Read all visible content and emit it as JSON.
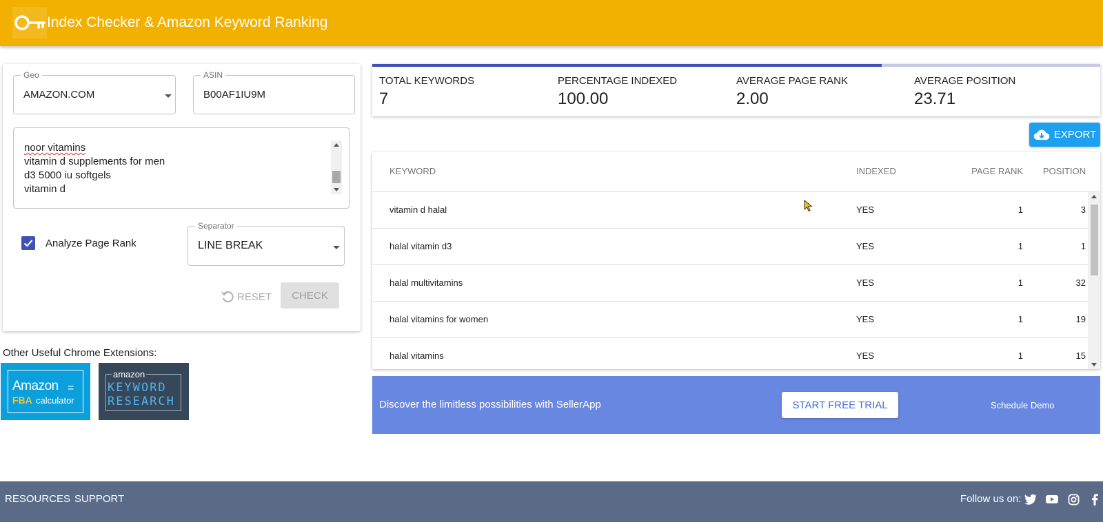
{
  "header": {
    "title": "Index Checker & Amazon Keyword Ranking",
    "logo_icon": "key-icon",
    "bg_color": "#f2b000"
  },
  "form": {
    "geo": {
      "label": "Geo",
      "value": "AMAZON.COM"
    },
    "asin": {
      "label": "ASIN",
      "value": "B00AF1IU9M"
    },
    "keywords": [
      "noor vitamins",
      "vitamin d supplements for men",
      "d3 5000 iu softgels",
      "vitamin d"
    ],
    "analyze_page_rank": {
      "label": "Analyze Page Rank",
      "checked": true
    },
    "separator": {
      "label": "Separator",
      "value": "LINE BREAK"
    },
    "reset_label": "RESET",
    "check_label": "CHECK"
  },
  "extensions": {
    "label": "Other Useful Chrome Extensions:",
    "fba": {
      "line1": "Amazon",
      "line2a": "FBA",
      "line2b": "calculator"
    },
    "kr": {
      "line1": "amazon",
      "line2": "KEYWORD",
      "line3": "RESEARCH"
    }
  },
  "stats": {
    "progress": 0.7,
    "items": [
      {
        "label": "TOTAL KEYWORDS",
        "value": "7"
      },
      {
        "label": "PERCENTAGE INDEXED",
        "value": "100.00"
      },
      {
        "label": "AVERAGE PAGE RANK",
        "value": "2.00"
      },
      {
        "label": "AVERAGE POSITION",
        "value": "23.71"
      }
    ]
  },
  "export_label": "EXPORT",
  "table": {
    "headers": {
      "keyword": "KEYWORD",
      "indexed": "INDEXED",
      "page_rank": "PAGE RANK",
      "position": "POSITION"
    },
    "rows": [
      {
        "keyword": "vitamin d halal",
        "indexed": "YES",
        "page_rank": "1",
        "position": "3"
      },
      {
        "keyword": "halal vitamin d3",
        "indexed": "YES",
        "page_rank": "1",
        "position": "1"
      },
      {
        "keyword": "halal multivitamins",
        "indexed": "YES",
        "page_rank": "1",
        "position": "32"
      },
      {
        "keyword": "halal vitamins for women",
        "indexed": "YES",
        "page_rank": "1",
        "position": "19"
      },
      {
        "keyword": "halal vitamins",
        "indexed": "YES",
        "page_rank": "1",
        "position": "15"
      }
    ]
  },
  "promo": {
    "text": "Discover the limitless possibilities with SellerApp",
    "trial_label": "START FREE TRIAL",
    "demo_label": "Schedule Demo",
    "bg_color": "#6887e0"
  },
  "footer": {
    "resources": "RESOURCES",
    "support": "SUPPORT",
    "follow": "Follow us on:",
    "icons": [
      "twitter-icon",
      "youtube-icon",
      "instagram-icon",
      "facebook-icon"
    ]
  }
}
